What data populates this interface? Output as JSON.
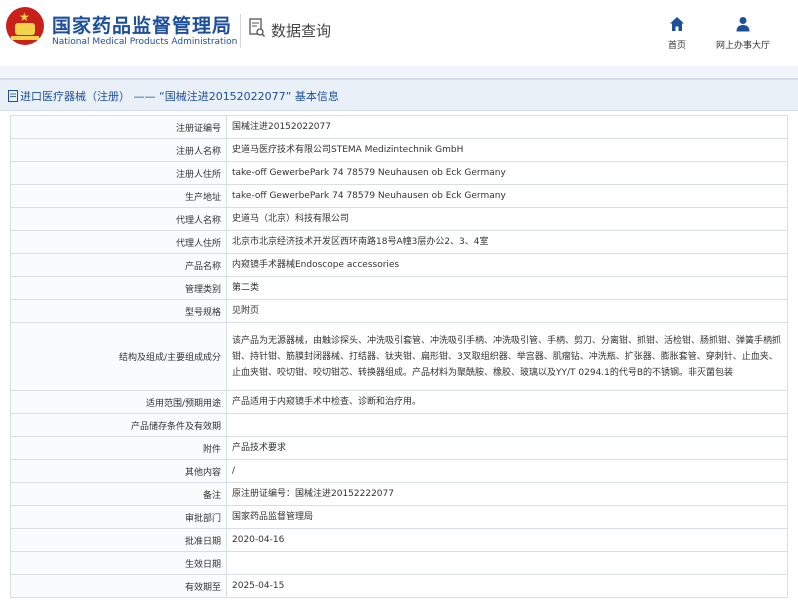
{
  "header": {
    "title_cn": "国家药品监督管理局",
    "title_en": "National Medical Products Administration",
    "query_label": "数据查询",
    "nav": {
      "home": "首页",
      "office": "网上办事大厅"
    }
  },
  "breadcrumb": "进口医疗器械（注册） —— “国械注进20152022077” 基本信息",
  "rows": [
    {
      "key": "注册证编号",
      "value": "国械注进20152022077"
    },
    {
      "key": "注册人名称",
      "value": "史道马医疗技术有限公司STEMA Medizintechnik GmbH"
    },
    {
      "key": "注册人住所",
      "value": "take-off GewerbePark 74 78579 Neuhausen ob Eck Germany"
    },
    {
      "key": "生产地址",
      "value": "take-off GewerbePark 74 78579 Neuhausen ob Eck Germany"
    },
    {
      "key": "代理人名称",
      "value": "史道马（北京）科技有限公司"
    },
    {
      "key": "代理人住所",
      "value": "北京市北京经济技术开发区西环南路18号A幢3层办公2、3、4室"
    },
    {
      "key": "产品名称",
      "value": "内窥镜手术器械Endoscope accessories"
    },
    {
      "key": "管理类别",
      "value": "第二类"
    },
    {
      "key": "型号规格",
      "value": "见附页"
    },
    {
      "key": "结构及组成/主要组成成分",
      "value": "该产品为无源器械，由触诊探头、冲洗吸引套管、冲洗吸引手柄、冲洗吸引管、手柄、剪刀、分离钳、抓钳、活检钳、肠抓钳、弹簧手柄抓钳、持针钳、筋膜封闭器械、打结器、钛夹钳、扁形钳、3叉取组织器、举宫器、肌瘤钻、冲洗瓶、扩张器、膨胀套管、穿刺针、止血夹、止血夹钳、咬切钳、咬切钳芯、转换器组成。产品材料为聚酰胺、橡胶、玻璃以及YY/T 0294.1的代号B的不锈钢。非灭菌包装"
    },
    {
      "key": "适用范围/预期用途",
      "value": "产品适用于内窥镜手术中检查、诊断和治疗用。"
    },
    {
      "key": "产品储存条件及有效期",
      "value": ""
    },
    {
      "key": "附件",
      "value": "产品技术要求"
    },
    {
      "key": "其他内容",
      "value": "/"
    },
    {
      "key": "备注",
      "value": "原注册证编号：国械注进20152222077"
    },
    {
      "key": "审批部门",
      "value": "国家药品监督管理局"
    },
    {
      "key": "批准日期",
      "value": "2020-04-16"
    },
    {
      "key": "生效日期",
      "value": ""
    },
    {
      "key": "有效期至",
      "value": "2025-04-15"
    }
  ]
}
